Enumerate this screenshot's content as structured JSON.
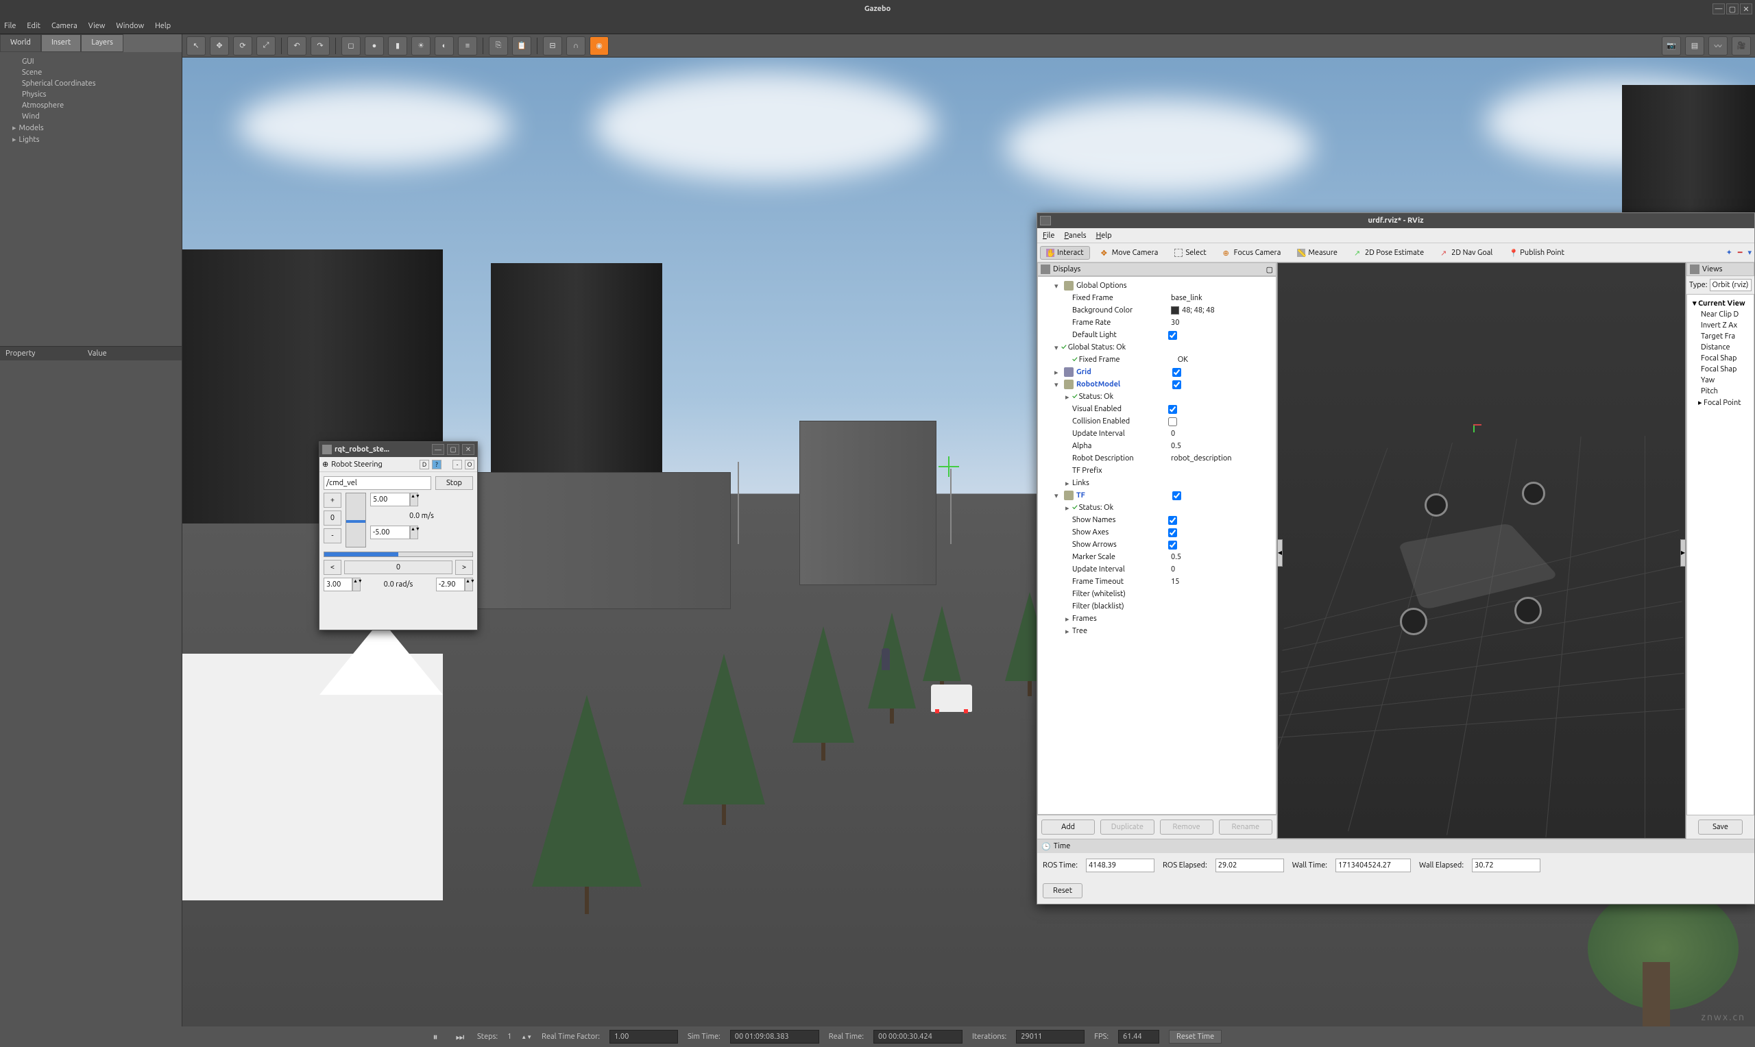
{
  "app": {
    "title": "Gazebo"
  },
  "menubar": [
    "File",
    "Edit",
    "Camera",
    "View",
    "Window",
    "Help"
  ],
  "lefttabs": [
    "World",
    "Insert",
    "Layers"
  ],
  "worldtree": [
    {
      "label": "GUI",
      "arrow": false
    },
    {
      "label": "Scene",
      "arrow": false
    },
    {
      "label": "Spherical Coordinates",
      "arrow": false
    },
    {
      "label": "Physics",
      "arrow": false
    },
    {
      "label": "Atmosphere",
      "arrow": false
    },
    {
      "label": "Wind",
      "arrow": false
    },
    {
      "label": "Models",
      "arrow": true
    },
    {
      "label": "Lights",
      "arrow": true
    }
  ],
  "prop": {
    "col1": "Property",
    "col2": "Value"
  },
  "status": {
    "steps_label": "Steps:",
    "steps": "1",
    "rtf_label": "Real Time Factor:",
    "rtf": "1.00",
    "simtime_label": "Sim Time:",
    "simtime": "00 01:09:08.383",
    "realtime_label": "Real Time:",
    "realtime": "00 00:00:30.424",
    "iter_label": "Iterations:",
    "iter": "29011",
    "fps_label": "FPS:",
    "fps": "61.44",
    "reset": "Reset Time"
  },
  "rviz": {
    "title": "urdf.rviz* - RViz",
    "menus": [
      "File",
      "Panels",
      "Help"
    ],
    "tools": [
      "Interact",
      "Move Camera",
      "Select",
      "Focus Camera",
      "Measure",
      "2D Pose Estimate",
      "2D Nav Goal",
      "Publish Point"
    ],
    "displays_title": "Displays",
    "tree": [
      {
        "indent": 1,
        "arrow": "▾",
        "icon": "globe",
        "label": "Global Options",
        "val": ""
      },
      {
        "indent": 2,
        "label": "Fixed Frame",
        "val": "base_link"
      },
      {
        "indent": 2,
        "label": "Background Color",
        "val": "48; 48; 48",
        "color": true
      },
      {
        "indent": 2,
        "label": "Frame Rate",
        "val": "30"
      },
      {
        "indent": 2,
        "label": "Default Light",
        "chk": true
      },
      {
        "indent": 1,
        "arrow": "▾",
        "check": true,
        "label": "Global Status: Ok"
      },
      {
        "indent": 2,
        "check": true,
        "label": "Fixed Frame",
        "val": "OK"
      },
      {
        "indent": 1,
        "arrow": "▸",
        "icon": "grid",
        "colorlabel": "Grid",
        "chk": true
      },
      {
        "indent": 1,
        "arrow": "▾",
        "icon": "robot",
        "colorlabel": "RobotModel",
        "chk": true
      },
      {
        "indent": 2,
        "arrow": "▸",
        "check": true,
        "label": "Status: Ok"
      },
      {
        "indent": 2,
        "label": "Visual Enabled",
        "chk": true
      },
      {
        "indent": 2,
        "label": "Collision Enabled",
        "chk": false
      },
      {
        "indent": 2,
        "label": "Update Interval",
        "val": "0"
      },
      {
        "indent": 2,
        "label": "Alpha",
        "val": "0.5"
      },
      {
        "indent": 2,
        "label": "Robot Description",
        "val": "robot_description"
      },
      {
        "indent": 2,
        "label": "TF Prefix",
        "val": ""
      },
      {
        "indent": 2,
        "arrow": "▸",
        "label": "Links"
      },
      {
        "indent": 1,
        "arrow": "▾",
        "icon": "tf",
        "colorlabel": "TF",
        "chk": true
      },
      {
        "indent": 2,
        "arrow": "▸",
        "check": true,
        "label": "Status: Ok"
      },
      {
        "indent": 2,
        "label": "Show Names",
        "chk": true
      },
      {
        "indent": 2,
        "label": "Show Axes",
        "chk": true
      },
      {
        "indent": 2,
        "label": "Show Arrows",
        "chk": true
      },
      {
        "indent": 2,
        "label": "Marker Scale",
        "val": "0.5"
      },
      {
        "indent": 2,
        "label": "Update Interval",
        "val": "0"
      },
      {
        "indent": 2,
        "label": "Frame Timeout",
        "val": "15"
      },
      {
        "indent": 2,
        "label": "Filter (whitelist)",
        "val": ""
      },
      {
        "indent": 2,
        "label": "Filter (blacklist)",
        "val": ""
      },
      {
        "indent": 2,
        "arrow": "▸",
        "label": "Frames"
      },
      {
        "indent": 2,
        "arrow": "▸",
        "label": "Tree"
      }
    ],
    "btns": {
      "add": "Add",
      "dup": "Duplicate",
      "rem": "Remove",
      "ren": "Rename"
    },
    "views_title": "Views",
    "views": {
      "typelabel": "Type:",
      "type": "Orbit (rviz)",
      "items": [
        "Current View",
        "Near Clip D",
        "Invert Z Ax",
        "Target Fra",
        "Distance",
        "Focal Shap",
        "Focal Shap",
        "Yaw",
        "Pitch",
        "Focal Point"
      ]
    },
    "save": "Save",
    "time": {
      "title": "Time",
      "rostimel": "ROS Time:",
      "rostime": "4148.39",
      "rosell": "ROS Elapsed:",
      "rosel": "29.02",
      "walll": "Wall Time:",
      "wall": "1713404524.27",
      "wallell": "Wall Elapsed:",
      "wallel": "30.72",
      "reset": "Reset"
    }
  },
  "rqt": {
    "title": "rqt_robot_ste...",
    "head": "Robot Steering",
    "topic": "/cmd_vel",
    "stop": "Stop",
    "plus": "+",
    "minus": "-",
    "zero": "0",
    "linmax": "5.00",
    "linmin": "-5.00",
    "linlabel": "0.0 m/s",
    "left": "<",
    "right": ">",
    "angmax": "3.00",
    "angmin": "-2.90",
    "anglabel": "0.0 rad/s",
    "angzero": "0"
  },
  "watermark": "znwx.cn"
}
